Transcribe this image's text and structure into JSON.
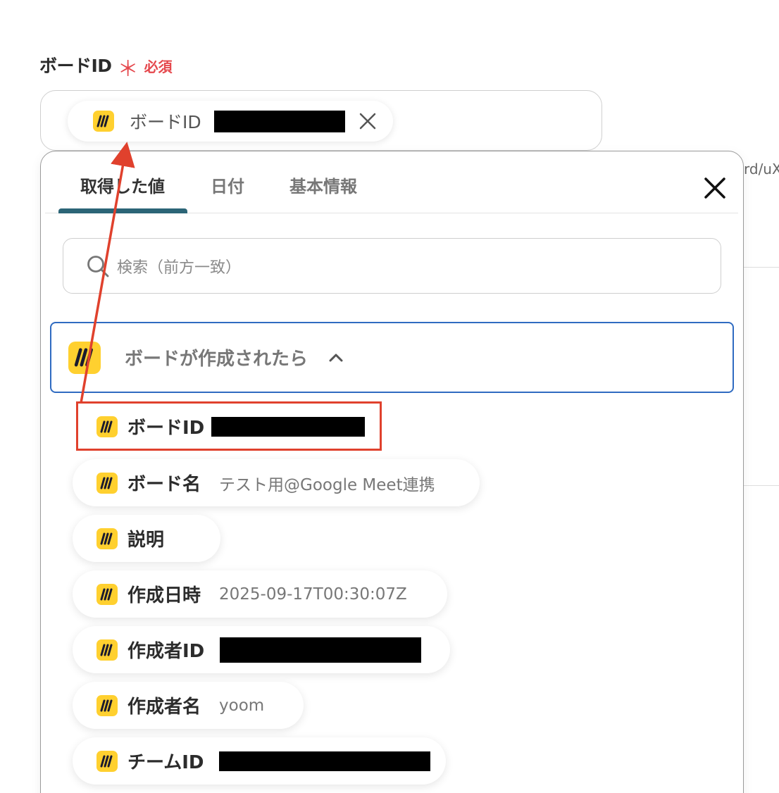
{
  "field": {
    "label": "ボードID",
    "required_mark": "＊",
    "required_text": "必須",
    "token_label": "ボードID"
  },
  "background": {
    "peek_text": "rd/uX"
  },
  "popup": {
    "tabs": [
      {
        "label": "取得した値",
        "active": true
      },
      {
        "label": "日付",
        "active": false
      },
      {
        "label": "基本情報",
        "active": false
      }
    ],
    "search_placeholder": "検索（前方一致）",
    "group": {
      "title": "ボードが作成されたら",
      "expanded": true
    },
    "items": [
      {
        "name": "ボードID",
        "value": "",
        "redacted": true
      },
      {
        "name": "ボード名",
        "value": "テスト用@Google Meet連携",
        "redacted": false
      },
      {
        "name": "説明",
        "value": "",
        "redacted": false
      },
      {
        "name": "作成日時",
        "value": "2025-09-17T00:30:07Z",
        "redacted": false
      },
      {
        "name": "作成者ID",
        "value": "",
        "redacted": true
      },
      {
        "name": "作成者名",
        "value": "yoom",
        "redacted": false
      },
      {
        "name": "チームID",
        "value": "",
        "redacted": true
      }
    ]
  },
  "colors": {
    "required": "#e5484d",
    "tab_underline": "#2c6577",
    "group_border": "#2f6bc1",
    "highlight": "#e0412d",
    "miro_yellow": "#ffd02f"
  },
  "icons": {
    "app": "miro-icon",
    "search": "search-icon",
    "close": "close-icon",
    "remove": "remove-token-icon",
    "collapse": "chevron-up-icon"
  }
}
